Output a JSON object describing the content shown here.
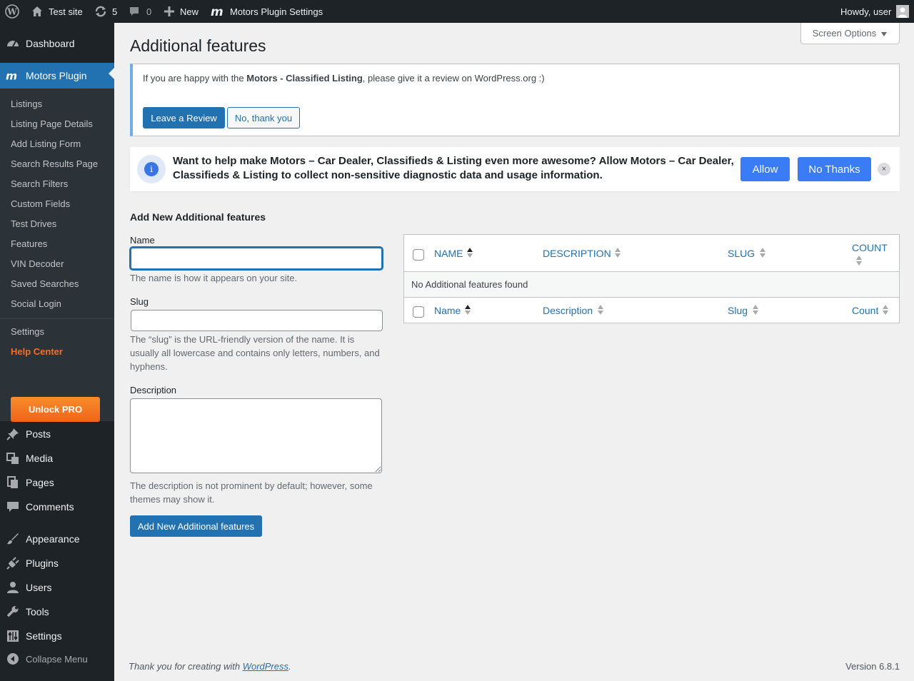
{
  "adminbar": {
    "site_name": "Test site",
    "updates_count": "5",
    "comments_count": "0",
    "new_label": "New",
    "plugin_settings": "Motors Plugin Settings",
    "howdy": "Howdy, user"
  },
  "sidebar": {
    "dashboard": "Dashboard",
    "motors_plugin": "Motors Plugin",
    "submenu": [
      "Listings",
      "Listing Page Details",
      "Add Listing Form",
      "Search Results Page",
      "Search Filters",
      "Custom Fields",
      "Test Drives",
      "Features",
      "VIN Decoder",
      "Saved Searches",
      "Social Login"
    ],
    "settings_sub": "Settings",
    "help_center": "Help Center",
    "unlock_pro": "Unlock PRO",
    "posts": "Posts",
    "media": "Media",
    "pages": "Pages",
    "comments": "Comments",
    "appearance": "Appearance",
    "plugins": "Plugins",
    "users": "Users",
    "tools": "Tools",
    "settings": "Settings",
    "collapse": "Collapse Menu"
  },
  "header": {
    "screen_options": "Screen Options",
    "title": "Additional features"
  },
  "review_notice": {
    "text_before": "If you are happy with the ",
    "plugin_name": "Motors - Classified Listing",
    "text_after": ", please give it a review on WordPress.org :)",
    "leave_review": "Leave a Review",
    "no_thanks": "No, thank you"
  },
  "optin_notice": {
    "message": "Want to help make Motors – Car Dealer, Classifieds & Listing even more awesome? Allow Motors – Car Dealer, Classifieds & Listing to collect non-sensitive diagnostic data and usage information.",
    "allow": "Allow",
    "no_thanks": "No Thanks",
    "close_icon": "×"
  },
  "form": {
    "heading": "Add New Additional features",
    "name_label": "Name",
    "name_value": "",
    "name_help": "The name is how it appears on your site.",
    "slug_label": "Slug",
    "slug_value": "",
    "slug_help": "The “slug” is the URL-friendly version of the name. It is usually all lowercase and contains only letters, numbers, and hyphens.",
    "description_label": "Description",
    "description_value": "",
    "description_help": "The description is not prominent by default; however, some themes may show it.",
    "submit": "Add New Additional features"
  },
  "table": {
    "header_columns": [
      "NAME",
      "DESCRIPTION",
      "SLUG",
      "COUNT"
    ],
    "footer_columns": [
      "Name",
      "Description",
      "Slug",
      "Count"
    ],
    "empty_message": "No Additional features found"
  },
  "footer": {
    "thanks_prefix": "Thank you for creating with ",
    "thanks_link": "WordPress",
    "thanks_suffix": ".",
    "version": "Version 6.8.1"
  },
  "colors": {
    "admin_dark": "#1d2327",
    "submenu_bg": "#2c3338",
    "accent_blue": "#2271b1",
    "optin_blue": "#3a7bf6",
    "help_orange": "#f56e28"
  }
}
